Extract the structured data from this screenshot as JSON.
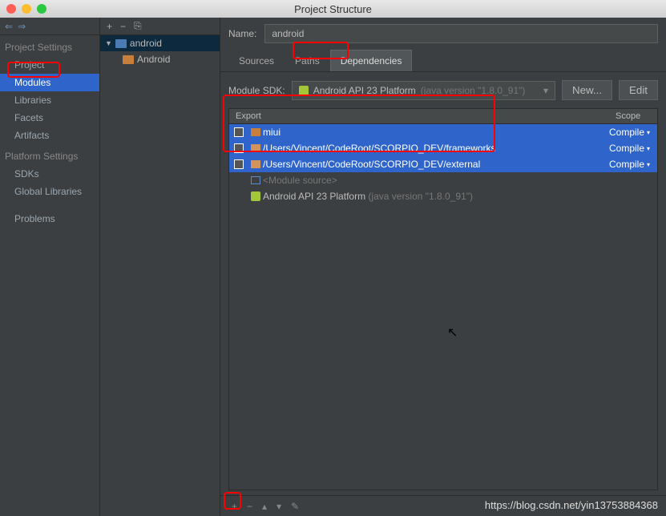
{
  "window": {
    "title": "Project Structure"
  },
  "sidebar": {
    "sections": [
      {
        "head": "Project Settings",
        "items": [
          "Project",
          "Modules",
          "Libraries",
          "Facets",
          "Artifacts"
        ]
      },
      {
        "head": "Platform Settings",
        "items": [
          "SDKs",
          "Global Libraries"
        ]
      },
      {
        "head": "",
        "items": [
          "Problems"
        ]
      }
    ],
    "selected": "Modules"
  },
  "tree": {
    "root": {
      "label": "android",
      "expanded": true
    },
    "children": [
      {
        "label": "Android"
      }
    ]
  },
  "name": {
    "label": "Name:",
    "value": "android"
  },
  "tabs": {
    "items": [
      "Sources",
      "Paths",
      "Dependencies"
    ],
    "active": "Dependencies"
  },
  "sdk": {
    "label": "Module SDK:",
    "value": "Android API 23 Platform",
    "hint": "(java version \"1.8.0_91\")",
    "new": "New...",
    "edit": "Edit"
  },
  "deps": {
    "head_export": "Export",
    "head_scope": "Scope",
    "rows": [
      {
        "type": "lib",
        "label": "miui",
        "scope": "Compile",
        "selected": true
      },
      {
        "type": "dir",
        "label": "/Users/Vincent/CodeRoot/SCORPIO_DEV/frameworks",
        "scope": "Compile",
        "selected": true
      },
      {
        "type": "dir",
        "label": "/Users/Vincent/CodeRoot/SCORPIO_DEV/external",
        "scope": "Compile",
        "selected": true
      },
      {
        "type": "mod",
        "label": "<Module source>",
        "scope": "",
        "selected": false
      },
      {
        "type": "sdk",
        "label": "Android API 23 Platform",
        "hint": "(java version \"1.8.0_91\")",
        "scope": "",
        "selected": false
      }
    ]
  },
  "watermark": "https://blog.csdn.net/yin13753884368"
}
